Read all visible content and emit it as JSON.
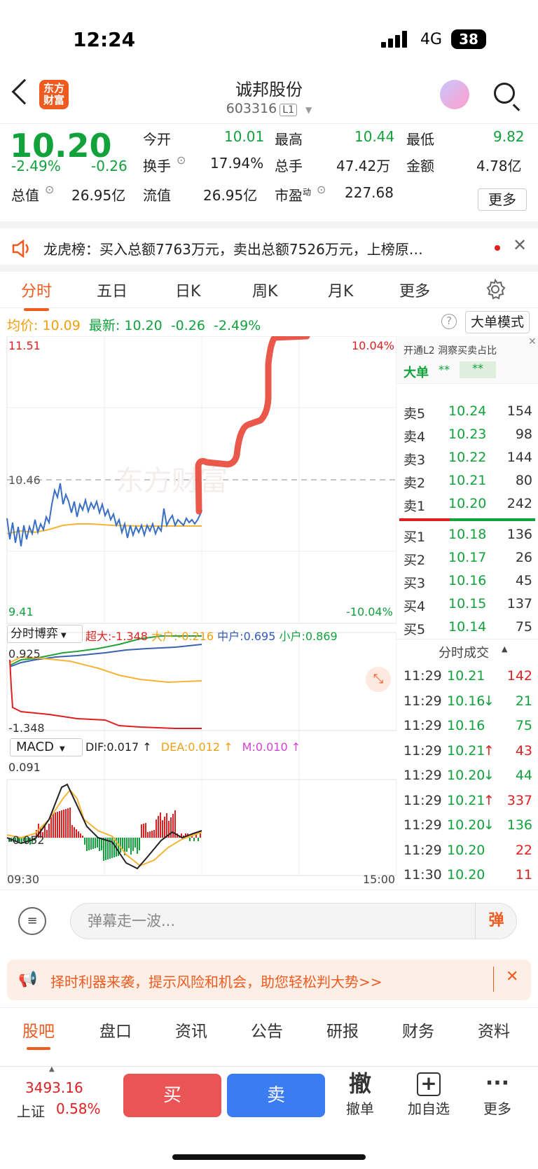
{
  "status_bar": {
    "time": "12:24",
    "network": "4G",
    "battery": "38"
  },
  "nav": {
    "logo_line1": "东方",
    "logo_line2": "财富",
    "title": "诚邦股份",
    "code": "603316",
    "level": "L1"
  },
  "quote": {
    "price": "10.20",
    "change_pct": "-2.49%",
    "change": "-0.26",
    "open_label": "今开",
    "open": "10.01",
    "high_label": "最高",
    "high": "10.44",
    "low_label": "最低",
    "low": "9.82",
    "turnover_label": "换手",
    "turnover": "17.94%",
    "volume_label": "总手",
    "volume": "47.42万",
    "amount_label": "金额",
    "amount": "4.78亿",
    "total_value_label": "总值",
    "total_value": "26.95亿",
    "float_value_label": "流值",
    "float_value": "26.95亿",
    "pe_label": "市盈",
    "pe_sup": "动",
    "pe": "227.68",
    "more": "更多"
  },
  "notice": {
    "text": "龙虎榜：买入总额7763万元，卖出总额7526万元，上榜原…"
  },
  "tabs": [
    "分时",
    "五日",
    "日K",
    "周K",
    "月K",
    "更多"
  ],
  "summary": {
    "avg_label": "均价:",
    "avg": "10.09",
    "latest_label": "最新:",
    "latest": "10.20",
    "chg": "-0.26",
    "chg_pct": "-2.49%",
    "big_mode": "大单模式"
  },
  "chart_labels": {
    "top_price": "11.51",
    "top_pct": "10.04%",
    "mid_price": "10.46",
    "bottom_price": "9.41",
    "bottom_pct": "-10.04%",
    "watermark": "东方财富",
    "time_start": "09:30",
    "time_end": "15:00"
  },
  "game": {
    "dropdown": "分时博弈",
    "super_label": "超大:",
    "super": "-1.348",
    "big_label": "大户:",
    "big": "-0.216",
    "mid_label": "中户:",
    "mid": "0.695",
    "small_label": "小户:",
    "small": "0.869",
    "top": "0.925",
    "bottom": "-1.348"
  },
  "macd": {
    "dropdown": "MACD",
    "dif": "DIF:0.017 ↑",
    "dea": "DEA:0.012 ↑",
    "m": "M:0.010 ↑",
    "top": "0.091",
    "bottom": "-0.052"
  },
  "side": {
    "header": "开通L2 洞察买卖占比",
    "big_order": "大单",
    "big_order_val1": "**",
    "big_order_val2": "**",
    "asks": [
      {
        "label": "卖5",
        "price": "10.24",
        "vol": "154"
      },
      {
        "label": "卖4",
        "price": "10.23",
        "vol": "98"
      },
      {
        "label": "卖3",
        "price": "10.22",
        "vol": "144"
      },
      {
        "label": "卖2",
        "price": "10.21",
        "vol": "80"
      },
      {
        "label": "卖1",
        "price": "10.20",
        "vol": "242"
      }
    ],
    "bids": [
      {
        "label": "买1",
        "price": "10.18",
        "vol": "136"
      },
      {
        "label": "买2",
        "price": "10.17",
        "vol": "26"
      },
      {
        "label": "买3",
        "price": "10.16",
        "vol": "45"
      },
      {
        "label": "买4",
        "price": "10.15",
        "vol": "137"
      },
      {
        "label": "买5",
        "price": "10.14",
        "vol": "75"
      }
    ],
    "trades_title": "分时成交",
    "trades": [
      {
        "time": "11:29",
        "price": "10.21",
        "dir": "",
        "vol": "142",
        "color": "#e02020"
      },
      {
        "time": "11:29",
        "price": "10.16",
        "dir": "↓",
        "vol": "21",
        "color": "#11a23c"
      },
      {
        "time": "11:29",
        "price": "10.16",
        "dir": "",
        "vol": "75",
        "color": "#11a23c"
      },
      {
        "time": "11:29",
        "price": "10.21",
        "dir": "↑",
        "vol": "43",
        "color": "#e02020"
      },
      {
        "time": "11:29",
        "price": "10.20",
        "dir": "↓",
        "vol": "44",
        "color": "#11a23c"
      },
      {
        "time": "11:29",
        "price": "10.21",
        "dir": "↑",
        "vol": "337",
        "color": "#e02020"
      },
      {
        "time": "11:29",
        "price": "10.20",
        "dir": "↓",
        "vol": "136",
        "color": "#11a23c"
      },
      {
        "time": "11:29",
        "price": "10.20",
        "dir": "",
        "vol": "22",
        "color": "#e02020"
      },
      {
        "time": "11:30",
        "price": "10.20",
        "dir": "",
        "vol": "11",
        "color": "#e02020"
      }
    ]
  },
  "comment": {
    "placeholder": "弹幕走一波...",
    "dan": "弹"
  },
  "banner": {
    "text": "择时利器来袭，提示风险和机会，助您轻松判大势>>"
  },
  "bottom_tabs": [
    "股吧",
    "盘口",
    "资讯",
    "公告",
    "研报",
    "财务",
    "资料"
  ],
  "bottom_bar": {
    "index_value": "3493.16",
    "index_name": "上证",
    "index_pct": "0.58%",
    "buy": "买",
    "sell": "卖",
    "cancel_icon": "撤",
    "cancel": "撤单",
    "add": "加自选",
    "more": "更多"
  },
  "colors": {
    "up": "#e02020",
    "down": "#11a23c",
    "brand": "#ef5a1f",
    "avg": "#f5b436",
    "price_line": "#3a6fc4"
  },
  "icons": [
    "back-arrow-icon",
    "search-icon",
    "gear-icon",
    "speaker-icon",
    "close-icon",
    "expand-icon",
    "question-icon",
    "plus-square-icon",
    "ellipsis-icon",
    "comment-list-icon"
  ]
}
